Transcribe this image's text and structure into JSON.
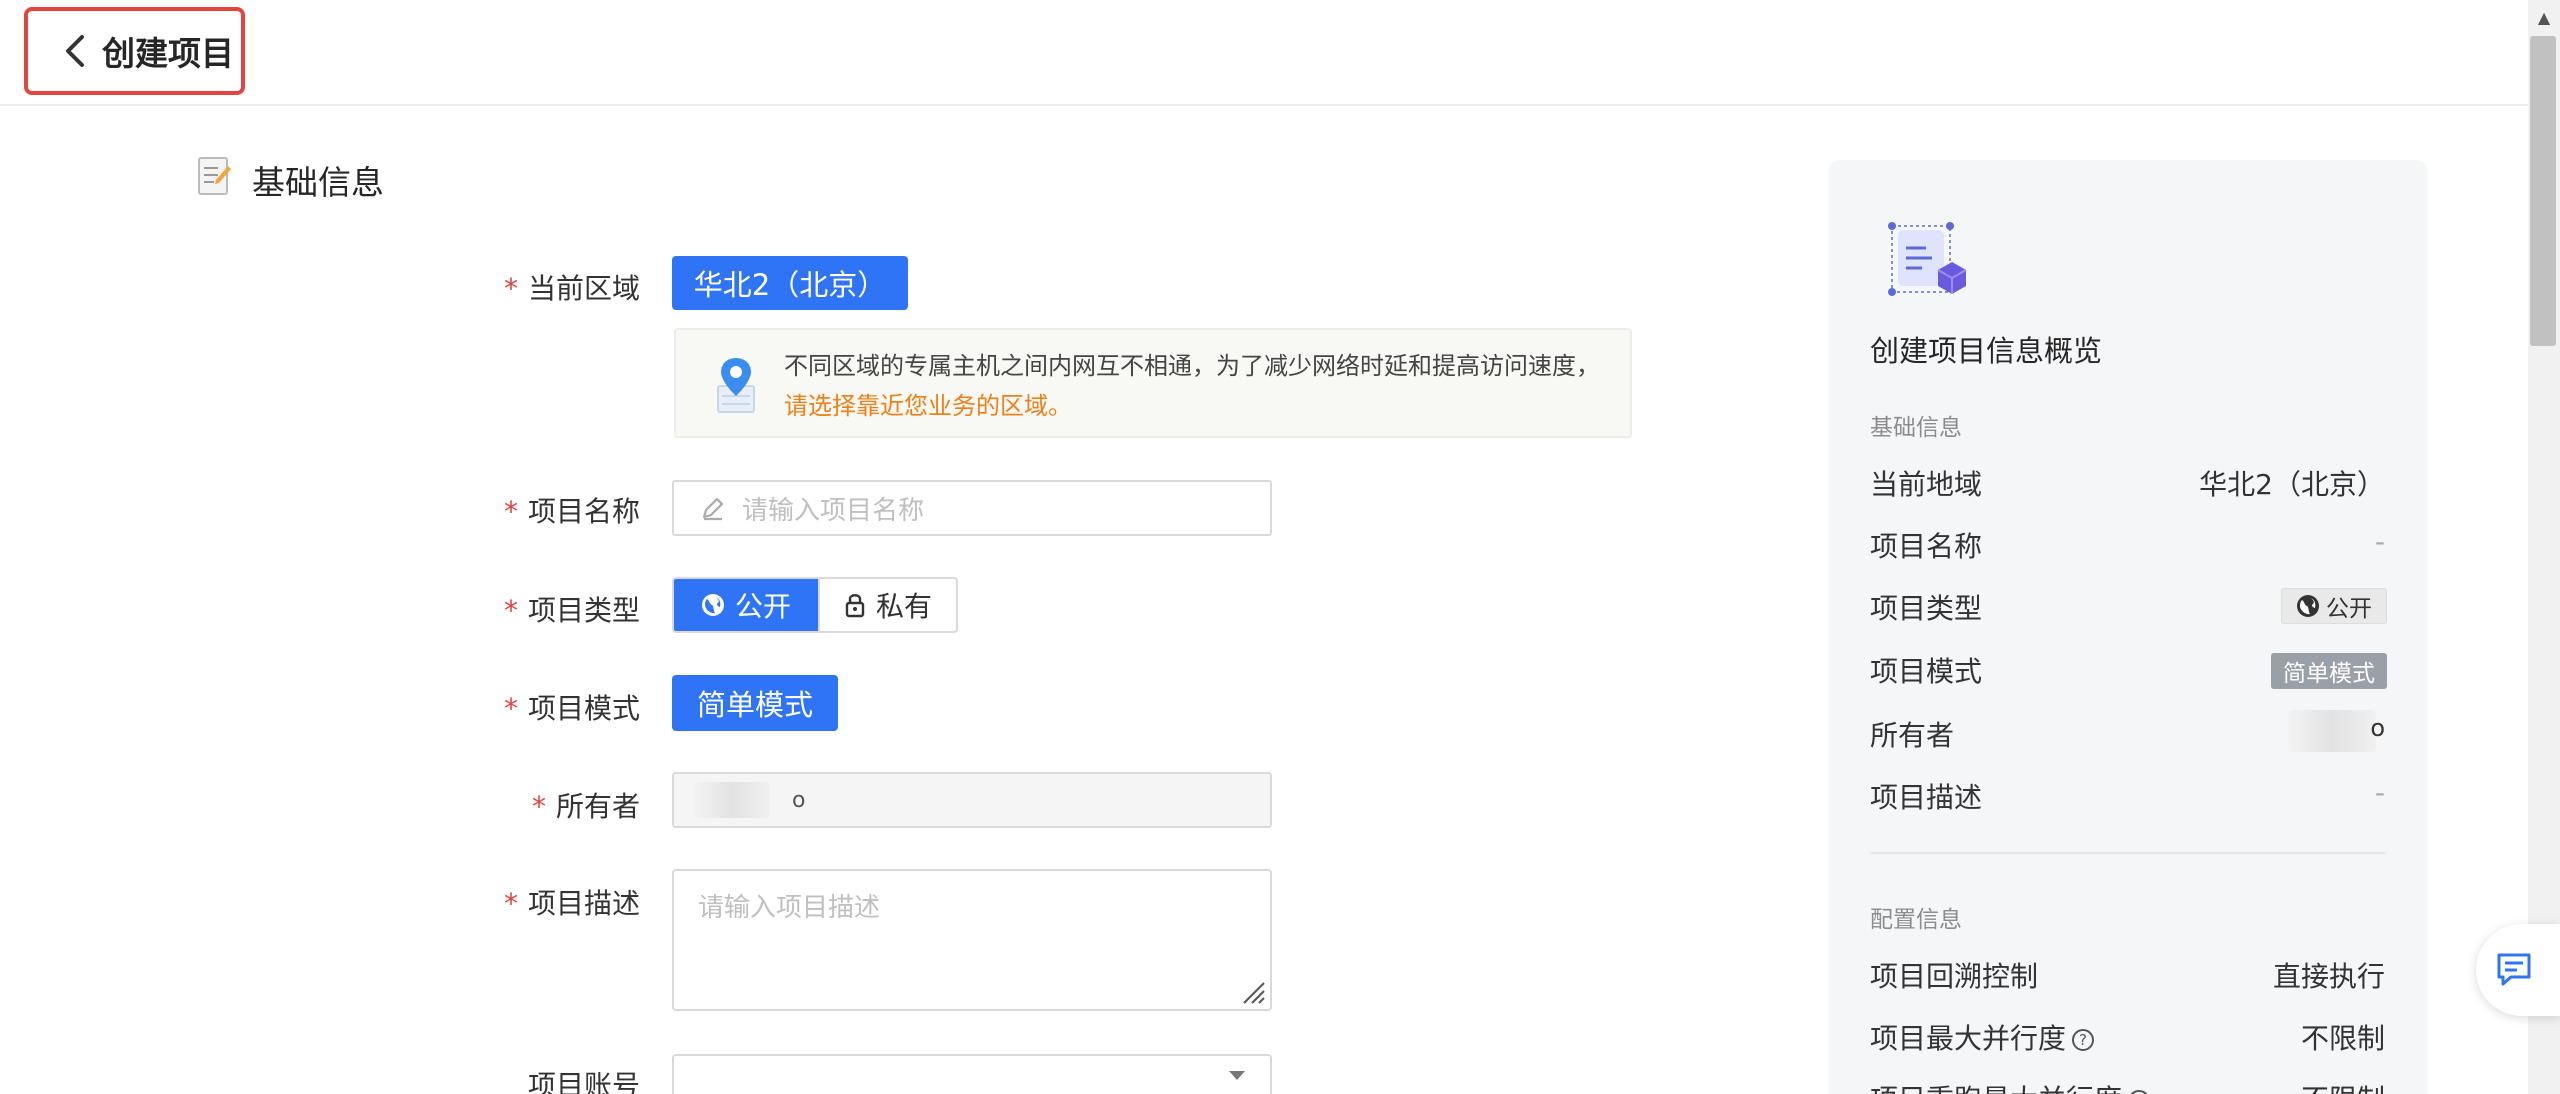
{
  "header": {
    "back_title": "创建项目"
  },
  "section": {
    "title": "基础信息"
  },
  "form": {
    "region_label": "当前区域",
    "region_value": "华北2（北京）",
    "region_notice": "不同区域的专属主机之间内网互不相通，为了减少网络时延和提高访问速度，",
    "region_notice_highlight": "请选择靠近您业务的区域。",
    "name_label": "项目名称",
    "name_placeholder": "请输入项目名称",
    "type_label": "项目类型",
    "type_public": "公开",
    "type_private": "私有",
    "mode_label": "项目模式",
    "mode_value": "简单模式",
    "owner_label": "所有者",
    "owner_value_tail": "o",
    "desc_label": "项目描述",
    "desc_placeholder": "请输入项目描述",
    "account_label": "项目账号"
  },
  "summary": {
    "title": "创建项目信息概览",
    "basic_heading": "基础信息",
    "rows": [
      {
        "label": "当前地域",
        "value": "华北2（北京）"
      },
      {
        "label": "项目名称",
        "value": "-"
      },
      {
        "label": "项目类型",
        "value": "公开"
      },
      {
        "label": "项目模式",
        "value": "简单模式"
      },
      {
        "label": "所有者",
        "value": "o"
      },
      {
        "label": "项目描述",
        "value": "-"
      }
    ],
    "config_heading": "配置信息",
    "config_rows": [
      {
        "label": "项目回溯控制",
        "value": "直接执行"
      },
      {
        "label": "项目最大并行度",
        "value": "不限制"
      },
      {
        "label": "项目重跑最大并行度",
        "value": "不限制"
      }
    ]
  },
  "colors": {
    "primary": "#2f74f5",
    "required": "#e3443f",
    "highlight": "#f07f18",
    "focus_outline": "#e3443f"
  },
  "icons": [
    "chevron-left-icon",
    "document-edit-icon",
    "location-pin-icon",
    "pencil-icon",
    "globe-icon",
    "lock-icon",
    "chevron-down-icon",
    "resize-handle-icon",
    "overview-illustration-icon",
    "question-icon",
    "feedback-icon"
  ]
}
